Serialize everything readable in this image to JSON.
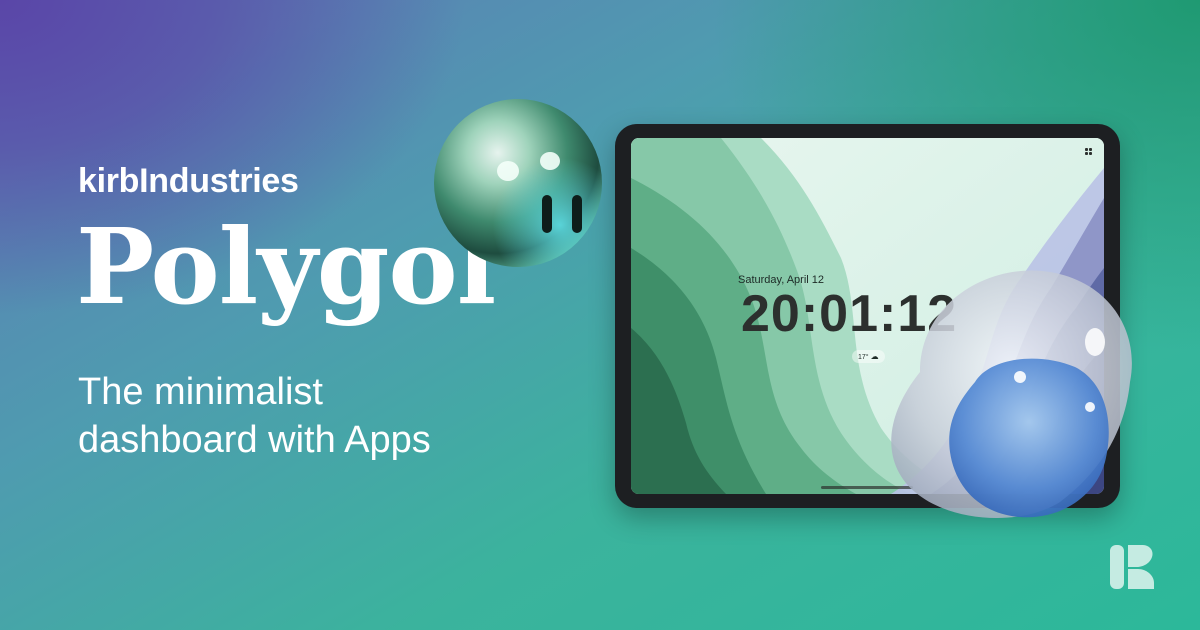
{
  "brand": "kirbIndustries",
  "title": "Polygol",
  "tagline_line1": "The minimalist",
  "tagline_line2": "dashboard with Apps",
  "tablet": {
    "date": "Saturday, April 12",
    "time": "20:01:12",
    "weather": "17°",
    "weather_icon": "cloud-icon"
  },
  "decorations": [
    "chrome-ball-face",
    "glass-blob-face"
  ],
  "logo_icon": "kirb-k-logo"
}
